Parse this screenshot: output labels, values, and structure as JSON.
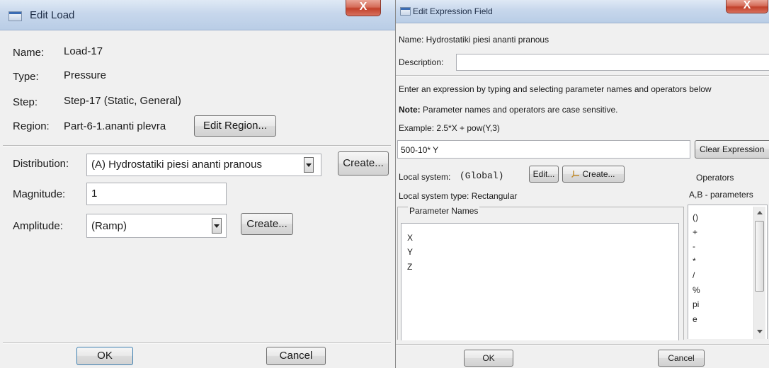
{
  "edit_load": {
    "title": "Edit Load",
    "close": "X",
    "name_label": "Name:",
    "name_value": "Load-17",
    "type_label": "Type:",
    "type_value": "Pressure",
    "step_label": "Step:",
    "step_value": "Step-17 (Static, General)",
    "region_label": "Region:",
    "region_value": "Part-6-1.ananti plevra",
    "edit_region_button": "Edit Region...",
    "distribution_label": "Distribution:",
    "distribution_value": "(A) Hydrostatiki piesi ananti pranous",
    "distribution_create": "Create...",
    "magnitude_label": "Magnitude:",
    "magnitude_value": "1",
    "amplitude_label": "Amplitude:",
    "amplitude_value": "(Ramp)",
    "amplitude_create": "Create...",
    "ok": "OK",
    "cancel": "Cancel"
  },
  "edit_expression": {
    "title": "Edit Expression Field",
    "close": "X",
    "name_line": "Name:  Hydrostatiki piesi ananti pranous",
    "description_label": "Description:",
    "description_value": "",
    "instruction": "Enter an expression by typing and selecting parameter names and operators below",
    "note_label": "Note:",
    "note_text": "Parameter names and operators are case sensitive.",
    "example": "Example:  2.5*X + pow(Y,3)",
    "expression_value": "500-10* Y",
    "clear_button": "Clear Expression",
    "local_system_label": "Local system:",
    "local_system_value": "(Global)",
    "edit_button": "Edit...",
    "create_button": "Create...",
    "local_system_type": "Local system type:  Rectangular",
    "parameter_names_title": "Parameter Names",
    "parameters": [
      "X",
      "Y",
      "Z"
    ],
    "operators_title": "Operators",
    "operators_subtitle": "A,B - parameters",
    "operators": [
      "()",
      "+",
      "-",
      "*",
      "/",
      "%",
      "pi",
      "e"
    ],
    "ok": "OK",
    "cancel": "Cancel"
  }
}
